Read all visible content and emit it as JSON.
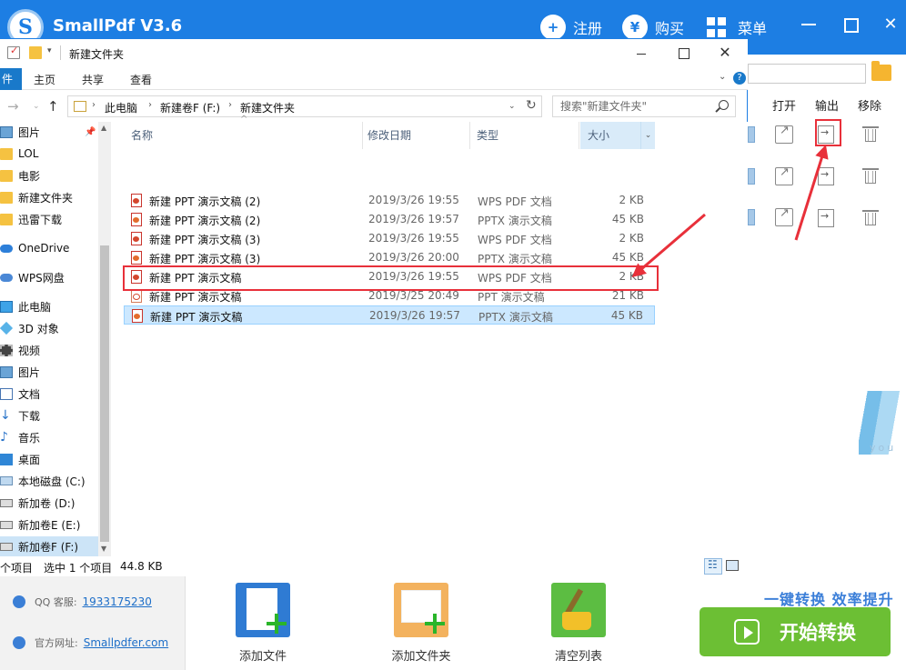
{
  "app": {
    "title": "SmallPdf V3.6",
    "logo_letter": "S",
    "nav": {
      "register": "注册",
      "buy": "购买",
      "menu": "菜单"
    },
    "columns": {
      "open": "打开",
      "export": "输出",
      "remove": "移除"
    },
    "brush_text": "you",
    "contact": {
      "qq_label": "QQ 客服:",
      "qq_value": "1933175230",
      "site_label": "官方网址:",
      "site_value": "Smallpdfer.com"
    },
    "tools": {
      "add_file": "添加文件",
      "add_folder": "添加文件夹",
      "clear_list": "清空列表"
    },
    "slogan": "一键转换  效率提升",
    "start_button": "开始转换",
    "accent_color": "#1d7ee3",
    "start_color": "#6cbf34",
    "highlight_color": "#e8303a"
  },
  "explorer": {
    "window_title": "新建文件夹",
    "ribbon": {
      "file": "件",
      "home": "主页",
      "share": "共享",
      "view": "查看"
    },
    "breadcrumb": [
      "此电脑",
      "新建卷F (F:)",
      "新建文件夹"
    ],
    "search_placeholder": "搜索\"新建文件夹\"",
    "nav_items": [
      "图片",
      "LOL",
      "电影",
      "新建文件夹",
      "迅雷下载",
      "OneDrive",
      "WPS网盘",
      "此电脑",
      "3D 对象",
      "视频",
      "图片",
      "文档",
      "下载",
      "音乐",
      "桌面",
      "本地磁盘 (C:)",
      "新加卷 (D:)",
      "新加卷E (E:)",
      "新加卷F (F:)"
    ],
    "headers": {
      "name": "名称",
      "date": "修改日期",
      "type": "类型",
      "size": "大小"
    },
    "files": [
      {
        "name": "新建 PPT 演示文稿 (2)",
        "date": "2019/3/26 19:55",
        "type": "WPS PDF 文档",
        "size": "2 KB",
        "kind": "pdf"
      },
      {
        "name": "新建 PPT 演示文稿 (2)",
        "date": "2019/3/26 19:57",
        "type": "PPTX 演示文稿",
        "size": "45 KB",
        "kind": "pptx"
      },
      {
        "name": "新建 PPT 演示文稿 (3)",
        "date": "2019/3/26 19:55",
        "type": "WPS PDF 文档",
        "size": "2 KB",
        "kind": "pdf"
      },
      {
        "name": "新建 PPT 演示文稿 (3)",
        "date": "2019/3/26 20:00",
        "type": "PPTX 演示文稿",
        "size": "45 KB",
        "kind": "pptx"
      },
      {
        "name": "新建 PPT 演示文稿",
        "date": "2019/3/26 19:55",
        "type": "WPS PDF 文档",
        "size": "2 KB",
        "kind": "pdf"
      },
      {
        "name": "新建 PPT 演示文稿",
        "date": "2019/3/25 20:49",
        "type": "PPT 演示文稿",
        "size": "21 KB",
        "kind": "ppt"
      },
      {
        "name": "新建 PPT 演示文稿",
        "date": "2019/3/26 19:57",
        "type": "PPTX 演示文稿",
        "size": "45 KB",
        "kind": "pptx",
        "selected": true
      }
    ],
    "status": {
      "count": "个项目",
      "selected": "选中 1 个项目",
      "size": "44.8 KB"
    }
  }
}
